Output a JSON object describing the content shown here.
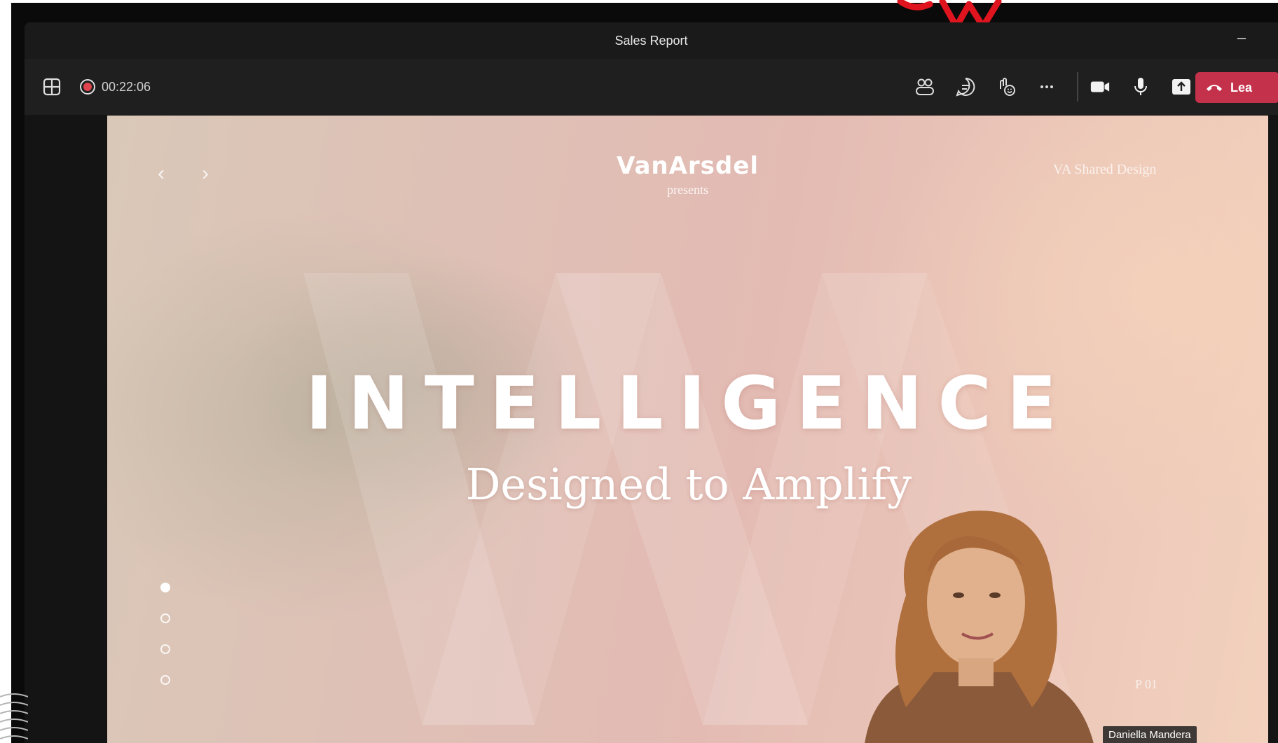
{
  "window": {
    "title": "Sales Report"
  },
  "toolbar": {
    "recording_time": "00:22:06",
    "left_icons": [
      "layout-icon",
      "record-icon"
    ],
    "right_icons": [
      "people-icon",
      "chat-icon",
      "react-icon",
      "more-icon",
      "camera-icon",
      "mic-icon",
      "share-icon"
    ],
    "leave_label": "Lea"
  },
  "slide": {
    "brand": "VanArsdel",
    "presents": "presents",
    "shared_design": "VA Shared Design",
    "headline": "INTELLIGENCE",
    "subheadline": "Designed to Amplify",
    "page": "P 01",
    "active_dot": 0,
    "dot_count": 4
  },
  "presenter": {
    "name": "Daniella Mandera"
  },
  "colors": {
    "leave": "#c4314b",
    "annotation": "#e0141e"
  }
}
